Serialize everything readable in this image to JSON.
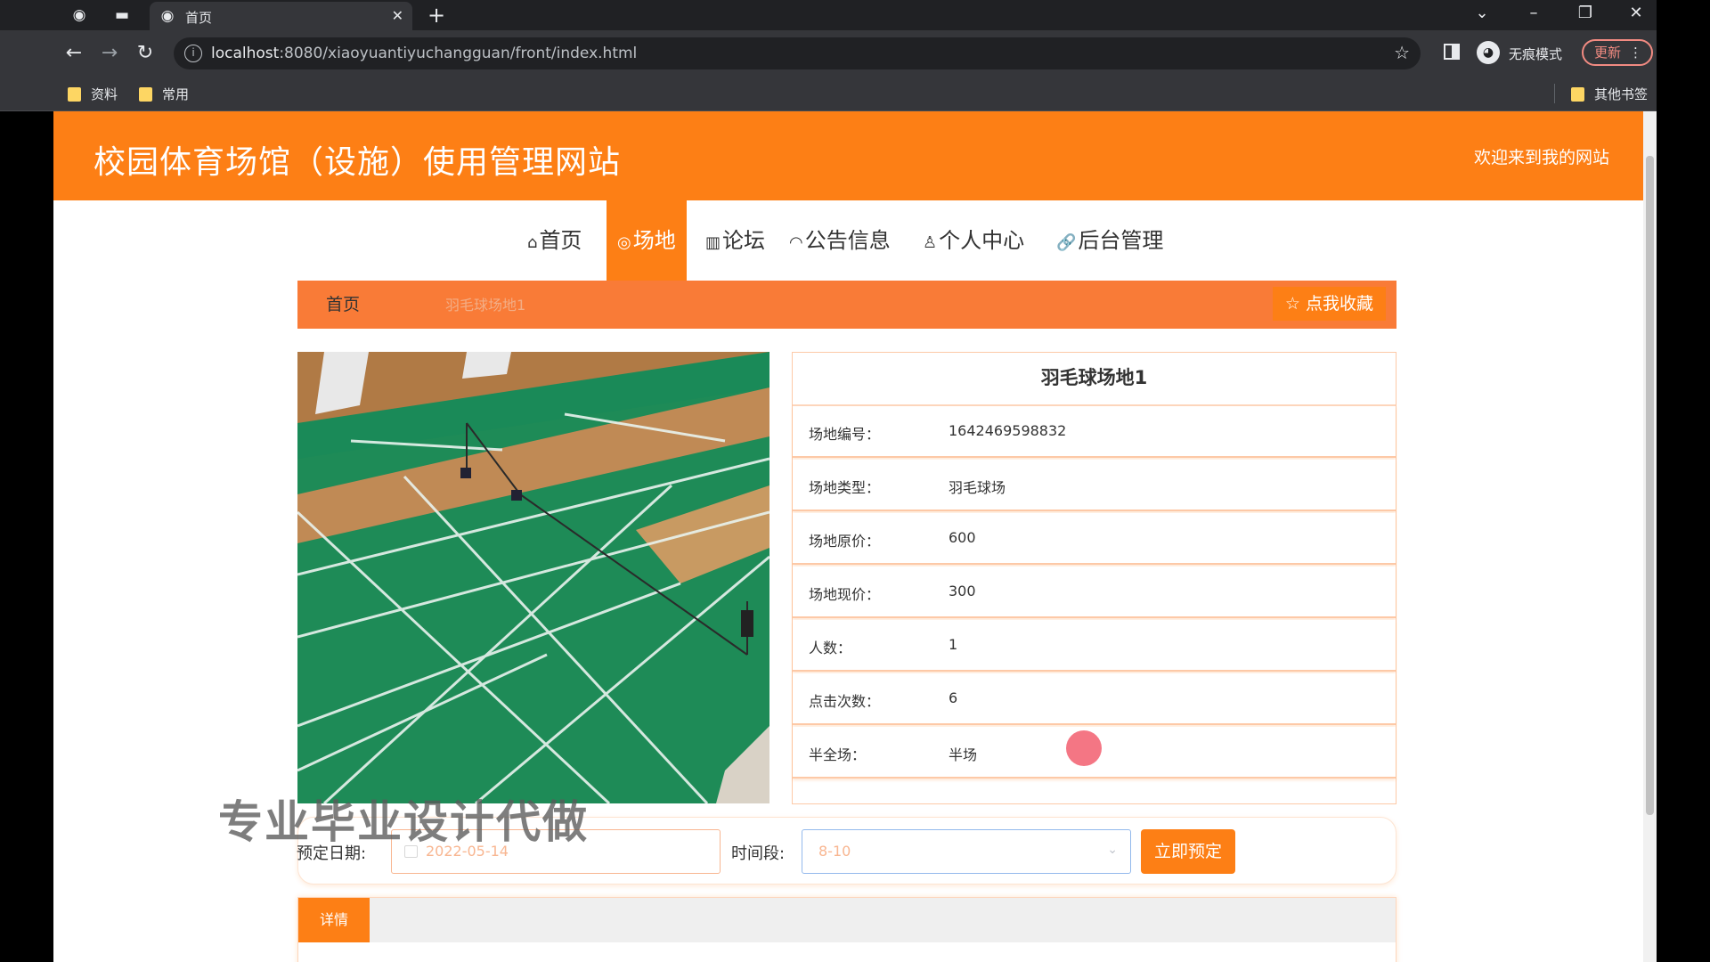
{
  "browser": {
    "tab_title": "首页",
    "new_tab_symbol": "+",
    "url_host": "localhost",
    "url_rest": ":8080/xiaoyuantiyuchangguan/front/index.html",
    "incognito_label": "无痕模式",
    "update_label": "更新",
    "bookmarks": [
      "资料",
      "常用"
    ],
    "other_bookmarks": "其他书签",
    "icons": {
      "globe": "globe-icon",
      "back": "back-arrow-icon",
      "forward": "forward-arrow-icon",
      "reload": "reload-icon",
      "star": "star-icon"
    }
  },
  "site": {
    "title": "校园体育场馆（设施）使用管理网站",
    "welcome": "欢迎来到我的网站",
    "accent_color": "#fd7f15"
  },
  "nav": {
    "items": [
      {
        "label": "首页",
        "icon": "⌂"
      },
      {
        "label": "场地",
        "icon": "◎",
        "active": true
      },
      {
        "label": "论坛",
        "icon": "▥"
      },
      {
        "label": "公告信息",
        "icon": "◠"
      },
      {
        "label": "个人中心",
        "icon": "♙"
      },
      {
        "label": "后台管理",
        "icon": "🔗"
      }
    ]
  },
  "breadcrumb": {
    "home": "首页",
    "current": "羽毛球场地1",
    "collect_label": "点我收藏"
  },
  "venue": {
    "name": "羽毛球场地1",
    "fields": [
      {
        "label": "场地编号：",
        "value": "1642469598832"
      },
      {
        "label": "场地类型：",
        "value": "羽毛球场"
      },
      {
        "label": "场地原价：",
        "value": "600"
      },
      {
        "label": "场地现价：",
        "value": "300"
      },
      {
        "label": "人数：",
        "value": "1"
      },
      {
        "label": "点击次数：",
        "value": "6"
      },
      {
        "label": "半全场：",
        "value": "半场"
      }
    ]
  },
  "booking": {
    "date_label": "预定日期:",
    "date_value": "2022-05-14",
    "time_label": "时间段:",
    "time_value": "8-10",
    "submit_label": "立即预定"
  },
  "details": {
    "tab_label": "详情"
  },
  "watermark": "专业毕业设计代做"
}
